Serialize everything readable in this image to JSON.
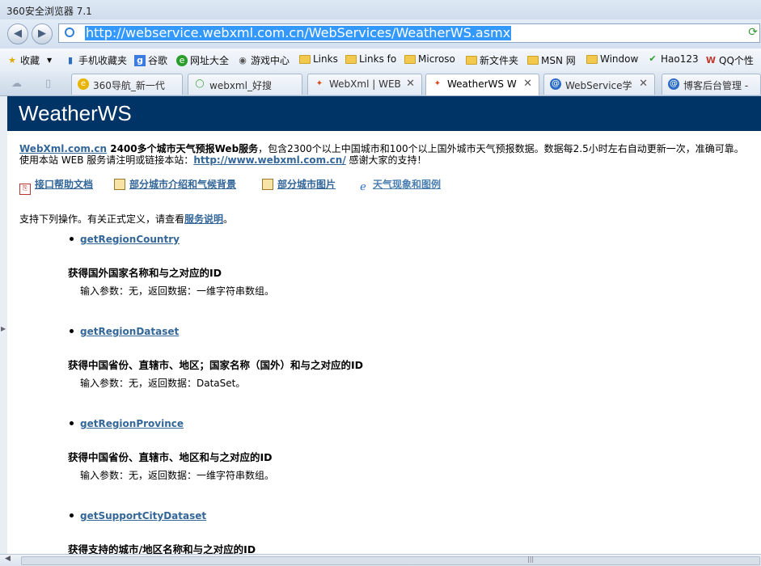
{
  "window": {
    "title": "360安全浏览器 7.1"
  },
  "nav": {
    "back_icon": "back-arrow-icon",
    "forward_icon": "forward-arrow-icon",
    "url": "http://webservice.webxml.com.cn/WebServices/WeatherWS.asmx"
  },
  "bookmarks": [
    {
      "label": "收藏",
      "icon": "star-icon"
    },
    {
      "label": "手机收藏夹",
      "icon": "phone-icon"
    },
    {
      "label": "谷歌",
      "icon": "google-icon"
    },
    {
      "label": "网址大全",
      "icon": "360-icon"
    },
    {
      "label": "游戏中心",
      "icon": "gamepad-icon"
    },
    {
      "label": "Links",
      "icon": "folder-icon"
    },
    {
      "label": "Links fo",
      "icon": "folder-icon"
    },
    {
      "label": "Microso",
      "icon": "folder-icon"
    },
    {
      "label": "新文件夹",
      "icon": "folder-icon"
    },
    {
      "label": "MSN 网",
      "icon": "folder-icon"
    },
    {
      "label": "Window",
      "icon": "folder-icon"
    },
    {
      "label": "Hao123",
      "icon": "hao123-icon"
    },
    {
      "label": "QQ个性",
      "icon": "qq-icon"
    }
  ],
  "tabs": [
    {
      "label": "360导航_新一代",
      "icon": "360-icon"
    },
    {
      "label": "webxml_好搜",
      "icon": "search-engine-icon"
    },
    {
      "label": "WebXml | WEB",
      "icon": "webxml-icon"
    },
    {
      "label": "WeatherWS W",
      "icon": "webxml-icon",
      "active": true
    },
    {
      "label": "WebService学",
      "icon": "blog-icon"
    },
    {
      "label": "博客后台管理 -",
      "icon": "blog-icon"
    }
  ],
  "page": {
    "header_title": "WeatherWS",
    "intro": {
      "site_link": "WebXml.com.cn",
      "bold_text": " 2400多个城市天气预报Web服务",
      "text": "，包含2300个以上中国城市和100个以上国外城市天气预报数据。数据每2.5小时左右自动更新一次，准确可靠。",
      "line2_text": "使用本站 WEB 服务请注明或链接本站：",
      "line2_link": "http://www.webxml.com.cn/",
      "line2_tail": " 感谢大家的支持！"
    },
    "doc_links": [
      {
        "label": "接口帮助文档",
        "icon": "pdf-icon"
      },
      {
        "label": "部分城市介绍和气候背景",
        "icon": "document-icon"
      },
      {
        "label": "部分城市图片",
        "icon": "document-icon"
      },
      {
        "label": "天气现象和图例",
        "icon": "ie-icon"
      }
    ],
    "support_text": "支持下列操作。有关正式定义，请查看",
    "support_link": "服务说明",
    "support_end": "。",
    "operations": [
      {
        "name": "getRegionCountry",
        "desc": "获得国外国家名称和与之对应的ID",
        "params": "输入参数：无，返回数据：一维字符串数组。"
      },
      {
        "name": "getRegionDataset",
        "desc": "获得中国省份、直辖市、地区；国家名称（国外）和与之对应的ID",
        "params": "输入参数：无，返回数据：DataSet。"
      },
      {
        "name": "getRegionProvince",
        "desc": "获得中国省份、直辖市、地区和与之对应的ID",
        "params": "输入参数：无，返回数据：一维字符串数组。"
      },
      {
        "name": "getSupportCityDataset",
        "desc": "获得支持的城市/地区名称和与之对应的ID",
        "params": ""
      }
    ]
  },
  "colors": {
    "header_bg": "#003366",
    "link": "#336699",
    "url_highlight": "#3399ff"
  }
}
